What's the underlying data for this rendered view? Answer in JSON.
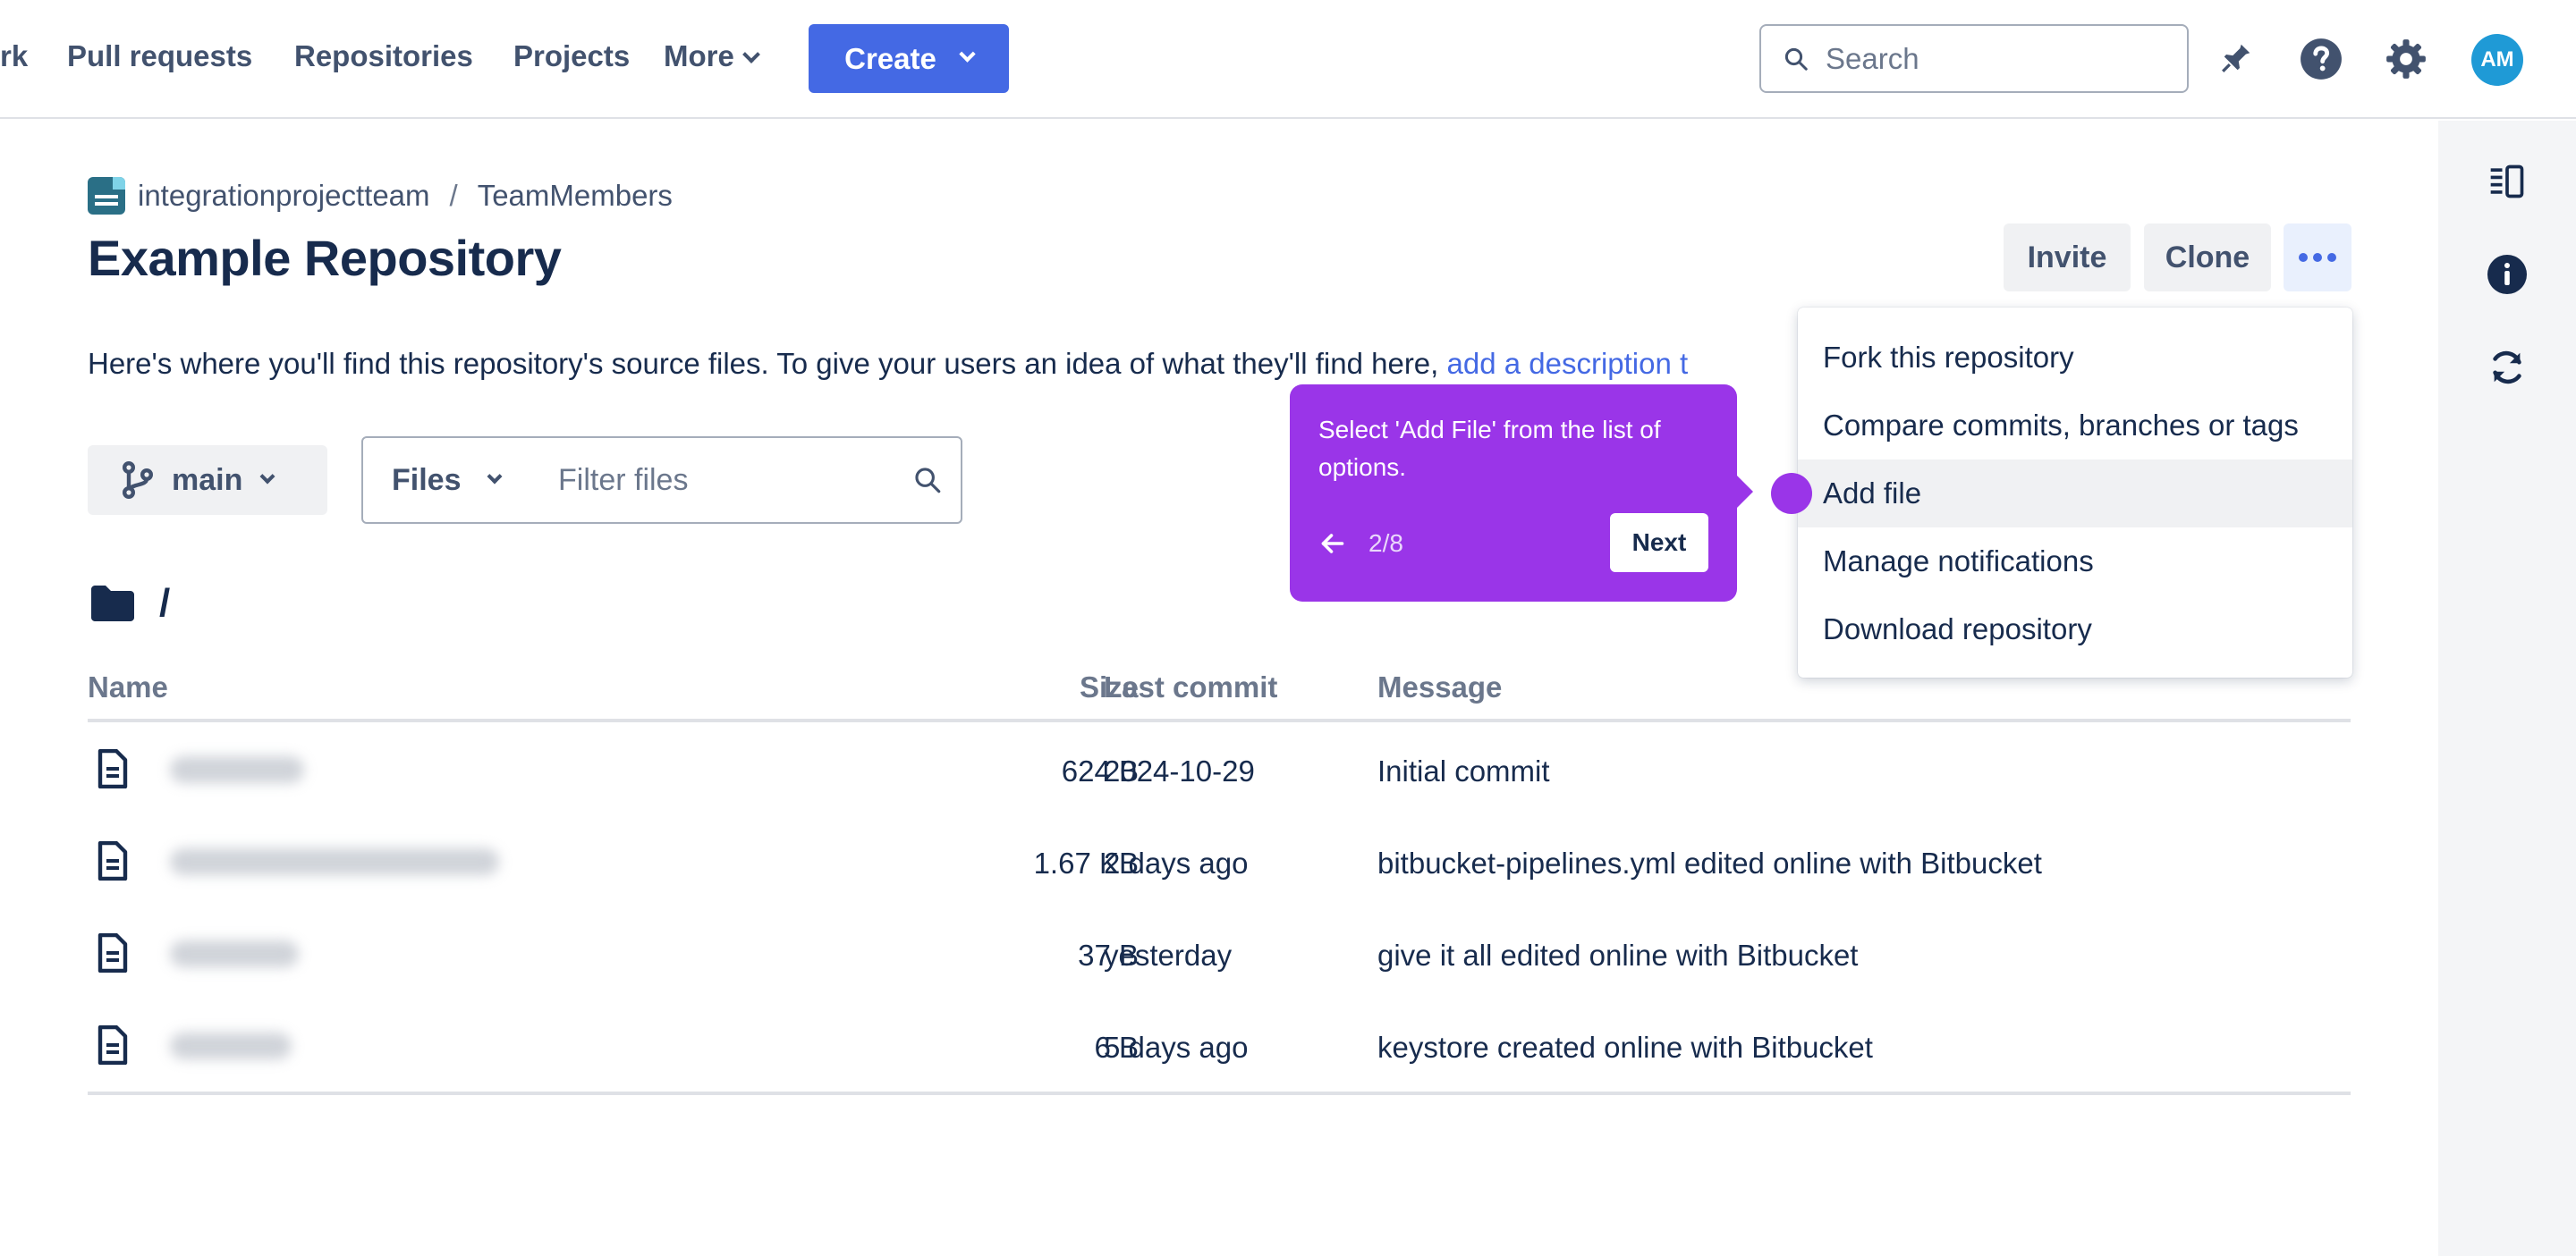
{
  "topnav": {
    "items": [
      {
        "label": "rk"
      },
      {
        "label": "Pull requests"
      },
      {
        "label": "Repositories"
      },
      {
        "label": "Projects"
      },
      {
        "label": "More"
      }
    ],
    "create_label": "Create",
    "search_placeholder": "Search",
    "avatar_initials": "AM"
  },
  "breadcrumb": {
    "workspace": "integrationprojectteam",
    "separator": "/",
    "project": "TeamMembers"
  },
  "page_title": "Example Repository",
  "actions": {
    "invite": "Invite",
    "clone": "Clone"
  },
  "description": {
    "text": "Here's where you'll find this repository's source files. To give your users an idea of what they'll find here, ",
    "link": "add a description t"
  },
  "branch": {
    "name": "main"
  },
  "filter": {
    "select_label": "Files",
    "placeholder": "Filter files"
  },
  "path": "/",
  "table": {
    "headers": {
      "name": "Name",
      "size": "Size",
      "last_commit": "Last commit",
      "message": "Message"
    },
    "rows": [
      {
        "size": "624 B",
        "last_commit": "2024-10-29",
        "message": "Initial commit"
      },
      {
        "size": "1.67 KB",
        "last_commit": "2 days ago",
        "message": "bitbucket-pipelines.yml edited online with Bitbucket"
      },
      {
        "size": "37 B",
        "last_commit": "yesterday",
        "message": "give it all edited online with Bitbucket"
      },
      {
        "size": "6 B",
        "last_commit": "5 days ago",
        "message": "keystore created online with Bitbucket"
      }
    ]
  },
  "dropdown": {
    "items": [
      {
        "label": "Fork this repository"
      },
      {
        "label": "Compare commits, branches or tags"
      },
      {
        "label": "Add file"
      },
      {
        "label": "Manage notifications"
      },
      {
        "label": "Download repository"
      }
    ],
    "active_item": "Add file"
  },
  "guide": {
    "text": "Select 'Add File' from the list of options.",
    "step": "2/8",
    "next_label": "Next",
    "color": "#9a35e8"
  },
  "colors": {
    "primary": "#4469e4",
    "text": "#172b4d",
    "muted": "#6b778c"
  },
  "icons": [
    "search-icon",
    "notification-icon",
    "help-icon",
    "settings-icon",
    "panel-toggle-icon",
    "info-icon",
    "sync-icon",
    "branch-icon",
    "folder-icon",
    "file-icon",
    "arrow-left-icon"
  ]
}
